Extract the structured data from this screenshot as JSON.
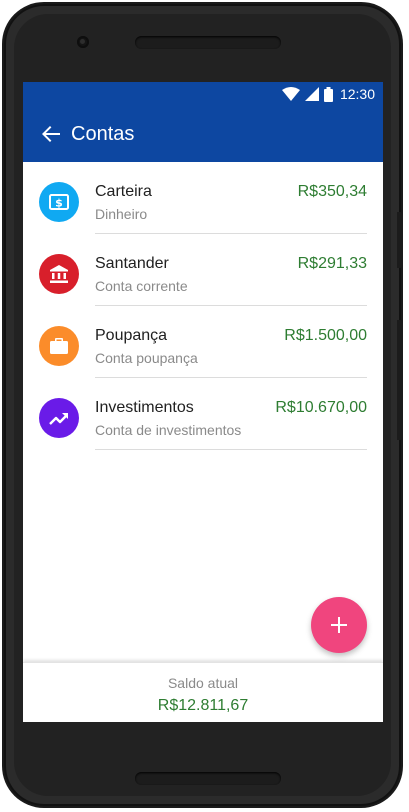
{
  "status": {
    "time": "12:30",
    "icons": [
      "wifi-icon",
      "signal-icon",
      "battery-icon"
    ]
  },
  "appbar": {
    "title": "Contas",
    "back_icon": "arrow-back-icon"
  },
  "accounts": [
    {
      "name": "Carteira",
      "type": "Dinheiro",
      "balance": "R$350,34",
      "icon": "cash-icon",
      "color": "#10a9f2"
    },
    {
      "name": "Santander",
      "type": "Conta corrente",
      "balance": "R$291,33",
      "icon": "bank-icon",
      "color": "#d81f2b"
    },
    {
      "name": "Poupança",
      "type": "Conta poupança",
      "balance": "R$1.500,00",
      "icon": "briefcase-icon",
      "color": "#fb8c2a"
    },
    {
      "name": "Investimentos",
      "type": "Conta de investimentos",
      "balance": "R$10.670,00",
      "icon": "trending-up-icon",
      "color": "#6a1be8"
    }
  ],
  "footer": {
    "label": "Saldo atual",
    "total": "R$12.811,67"
  },
  "colors": {
    "primary": "#0d47a1",
    "accent": "#f0457e",
    "positive": "#2e7d32"
  }
}
